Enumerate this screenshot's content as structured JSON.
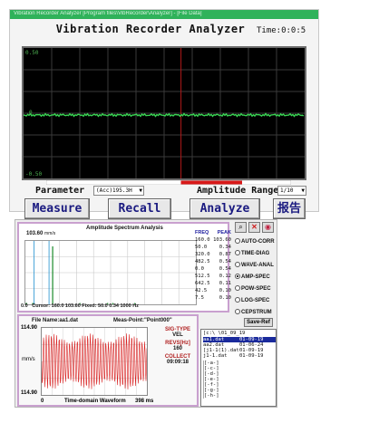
{
  "top_window": {
    "titlebar_text": "Vibration Recorder Analyzer  [Program files\\VibRecorder\\Analyzer] - [File Data]",
    "app_title": "Vibration Recorder Analyzer",
    "time_label": "Time:0:0:5",
    "scope": {
      "y_top": "0.50",
      "y_mid": "0",
      "y_bot": "-0.50",
      "trace_color": "#39d353",
      "background": "#000000",
      "grid_color": "#3a3a3a"
    },
    "parameter_label": "Parameter",
    "parameter_value": "(Acc)195.3H",
    "amplitude_range_label": "Amplitude Range",
    "amplitude_range_value": "1/10",
    "buttons": {
      "measure": "Measure",
      "recall": "Recall",
      "analyze": "Analyze",
      "report": "报告"
    },
    "level_bar": {
      "colors": [
        "#ffffff",
        "#ffffff",
        "#d81818",
        "#ffffff"
      ],
      "fill_fraction": 0.62
    }
  },
  "bottom_window": {
    "spectrum": {
      "title": "Amplitude Spectrum Analysis",
      "peak_value": "103.60",
      "peak_unit": "mm/s",
      "cursor_line": "Cursor:  160.0   103.60   Fixed:  50.0    0.34     1000   Hz",
      "x_zero": "0.0",
      "table_headers": [
        "FREQ",
        "PEAK"
      ],
      "table_rows": [
        [
          "160.0",
          "103.60"
        ],
        [
          "50.0",
          "0.34"
        ],
        [
          "320.0",
          "0.87"
        ],
        [
          "482.5",
          "0.54"
        ],
        [
          "0.0",
          "0.54"
        ],
        [
          "512.5",
          "0.12"
        ],
        [
          "642.5",
          "0.11"
        ],
        [
          "42.5",
          "0.10"
        ],
        [
          "7.5",
          "0.10"
        ]
      ]
    },
    "toolbar_icons": [
      "zoom-icon",
      "close-icon",
      "gauge-icon"
    ],
    "analysis_modes": [
      {
        "label": "AUTO-CORR",
        "selected": false
      },
      {
        "label": "TIME-DIAG",
        "selected": false
      },
      {
        "label": "WAVE-ANAL",
        "selected": false
      },
      {
        "label": "AMP-SPEC",
        "selected": true
      },
      {
        "label": "POW-SPEC",
        "selected": false
      },
      {
        "label": "LOG-SPEC",
        "selected": false
      },
      {
        "label": "CEPSTRUM",
        "selected": false
      }
    ],
    "waveform": {
      "file_name": "File Name:aa1.dat",
      "meas_point": "Meas-Point:\"Point000\"",
      "y_top": "114.90",
      "y_unit": "mm/s",
      "y_bot": "114.90",
      "x_zero": "0",
      "x_label": "Time-domain Waveform",
      "x_end": "398   ms",
      "trace_color": "#d82020"
    },
    "info": {
      "sig_type_label": "SIG-TYPE",
      "sig_type_value": "VEL",
      "revs_label": "REVS[Hz]",
      "revs_value": "160",
      "collect_label": "COLLECT",
      "collect_value": "09:09:18"
    },
    "save_ref": "Save-Ref",
    "file_browser": {
      "dir": "[c:\\   \\01_09_19",
      "files": [
        {
          "name": "aa1.dat",
          "date": "01-09-19",
          "selected": true
        },
        {
          "name": "aa2.dat",
          "date": "01-06-24",
          "selected": false
        },
        {
          "name": "[j1-1(1).dat",
          "date": "01-09-19",
          "selected": false
        },
        {
          "name": "j1-1.dat",
          "date": "01-09-19",
          "selected": false
        }
      ],
      "drives": [
        "[-a-]",
        "[-c-]",
        "[-d-]",
        "[-e-]",
        "[-f-]",
        "[-g-]",
        "[-h-]"
      ]
    }
  }
}
